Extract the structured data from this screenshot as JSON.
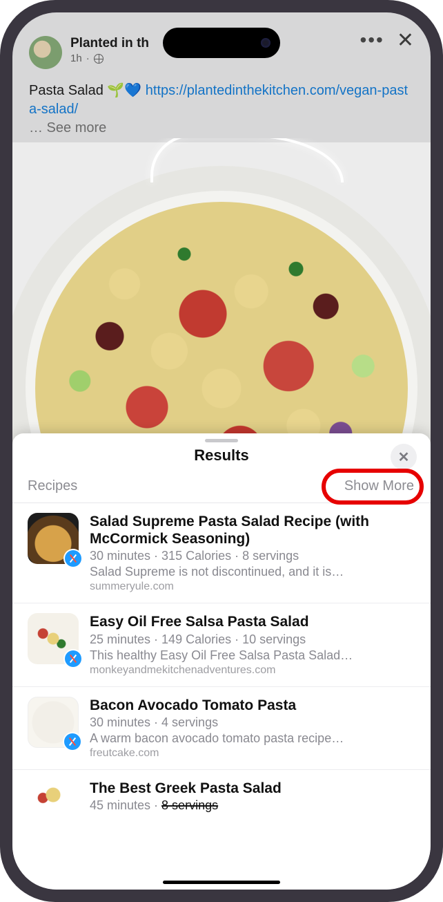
{
  "post": {
    "page_name": "Planted in th",
    "time": "1h",
    "privacy_icon": "globe-icon",
    "text_prefix": "Pasta Salad 🌱💙 ",
    "link_text": "https://plantedinthekitchen.com/vegan-pasta-salad/",
    "see_more": "… See more"
  },
  "sheet": {
    "title": "Results",
    "section_label": "Recipes",
    "show_more": "Show More"
  },
  "results": [
    {
      "title": "Salad Supreme Pasta Salad Recipe (with McCormick Seasoning)",
      "sub": "30 minutes · 315 Calories · 8 servings",
      "desc": "Salad Supreme is not discontinued, and it is…",
      "source": "summeryule.com"
    },
    {
      "title": "Easy Oil Free Salsa Pasta Salad",
      "sub": "25 minutes · 149 Calories · 10 servings",
      "desc": "This healthy Easy Oil Free Salsa Pasta Salad…",
      "source": "monkeyandmekitchenadventures.com"
    },
    {
      "title": "Bacon Avocado Tomato Pasta",
      "sub": "30 minutes · 4 servings",
      "desc": "A warm bacon avocado tomato pasta recipe…",
      "source": "freutcake.com"
    },
    {
      "title": "The Best Greek Pasta Salad",
      "sub_pre": "45 minutes · ",
      "sub_strike": "8 servings"
    }
  ]
}
